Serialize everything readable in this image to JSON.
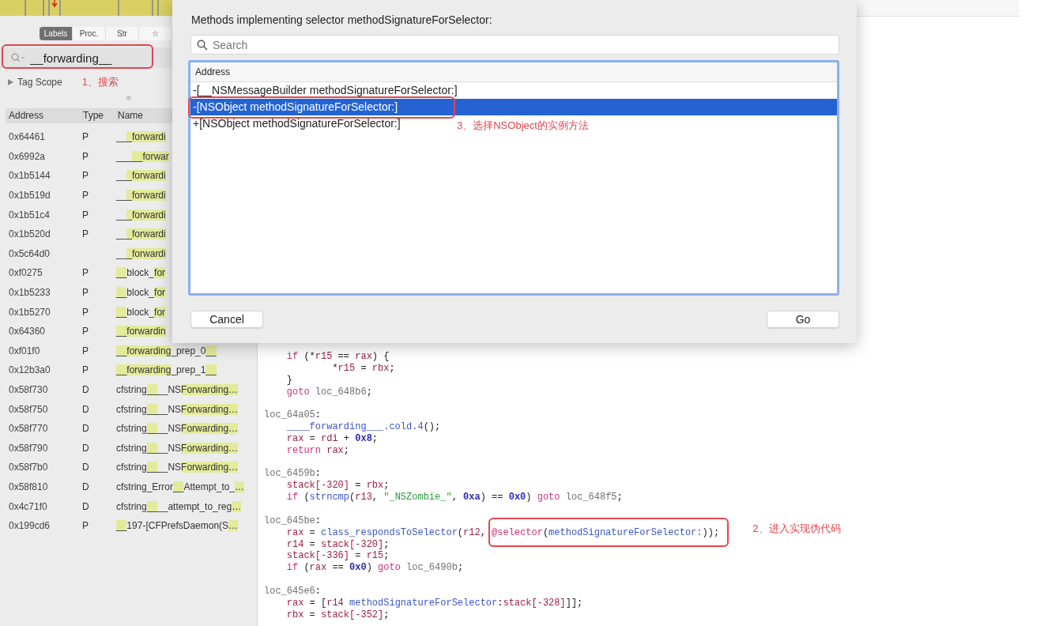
{
  "sidebar": {
    "tabs": [
      {
        "label": "Labels",
        "selected": true
      },
      {
        "label": "Proc.",
        "selected": false
      },
      {
        "label": "Str",
        "selected": false
      },
      {
        "label": "☆",
        "selected": false
      }
    ],
    "search": {
      "value": "__forwarding__"
    },
    "tag_scope": {
      "label": "Tag Scope",
      "expanded": false
    },
    "note": "1、搜索",
    "table": {
      "columns": [
        "Address",
        "Type",
        "Name"
      ],
      "rows": [
        {
          "address": "0x64461",
          "type": "P",
          "name": [
            {
              "text": "__",
              "match": false
            },
            {
              "text": "_forwardi",
              "match": true
            }
          ]
        },
        {
          "address": "0x6992a",
          "type": "P",
          "name": [
            {
              "text": "___",
              "match": false
            },
            {
              "text": "__forwar",
              "match": true
            }
          ]
        },
        {
          "address": "0x1b5144",
          "type": "P",
          "name": [
            {
              "text": "__",
              "match": false
            },
            {
              "text": "_forwardi",
              "match": true
            }
          ]
        },
        {
          "address": "0x1b519d",
          "type": "P",
          "name": [
            {
              "text": "__",
              "match": false
            },
            {
              "text": "_forwardi",
              "match": true
            }
          ]
        },
        {
          "address": "0x1b51c4",
          "type": "P",
          "name": [
            {
              "text": "__",
              "match": false
            },
            {
              "text": "_forwardi",
              "match": true
            }
          ]
        },
        {
          "address": "0x1b520d",
          "type": "P",
          "name": [
            {
              "text": "__",
              "match": false
            },
            {
              "text": "_forwardi",
              "match": true
            }
          ]
        },
        {
          "address": "0x5c64d0",
          "name": [
            {
              "text": "__",
              "match": false
            },
            {
              "text": "_forwardi",
              "match": true
            }
          ]
        },
        {
          "address": "0xf0275",
          "type": "P",
          "name": [
            {
              "text": "__",
              "match": true
            },
            {
              "text": "block_",
              "match": false
            },
            {
              "text": "for",
              "match": true
            }
          ]
        },
        {
          "address": "0x1b5233",
          "type": "P",
          "name": [
            {
              "text": "__",
              "match": true
            },
            {
              "text": "block_",
              "match": false
            },
            {
              "text": "for",
              "match": true
            }
          ]
        },
        {
          "address": "0x1b5270",
          "type": "P",
          "name": [
            {
              "text": "__",
              "match": true
            },
            {
              "text": "block_",
              "match": false
            },
            {
              "text": "for",
              "match": true
            }
          ]
        },
        {
          "address": "0x64360",
          "type": "P",
          "name": [
            {
              "text": "__forwardin",
              "match": true
            }
          ]
        },
        {
          "address": "0xf01f0",
          "type": "P",
          "name": [
            {
              "text": "__forwarding",
              "match": true
            },
            {
              "text": "_prep_0",
              "match": false
            },
            {
              "text": "__",
              "match": true
            }
          ]
        },
        {
          "address": "0x12b3a0",
          "type": "P",
          "name": [
            {
              "text": "__forwarding",
              "match": true
            },
            {
              "text": "_prep_1",
              "match": false
            },
            {
              "text": "__",
              "match": true
            }
          ]
        },
        {
          "address": "0x58f730",
          "type": "D",
          "name": [
            {
              "text": "cfstring",
              "match": false
            },
            {
              "text": "__",
              "match": true
            },
            {
              "text": "__NS",
              "match": false
            },
            {
              "text": "Forwarding…",
              "match": true
            }
          ]
        },
        {
          "address": "0x58f750",
          "type": "D",
          "name": [
            {
              "text": "cfstring",
              "match": false
            },
            {
              "text": "__",
              "match": true
            },
            {
              "text": "__NS",
              "match": false
            },
            {
              "text": "Forwarding…",
              "match": true
            }
          ]
        },
        {
          "address": "0x58f770",
          "type": "D",
          "name": [
            {
              "text": "cfstring",
              "match": false
            },
            {
              "text": "__",
              "match": true
            },
            {
              "text": "__NS",
              "match": false
            },
            {
              "text": "Forwarding…",
              "match": true
            }
          ]
        },
        {
          "address": "0x58f790",
          "type": "D",
          "name": [
            {
              "text": "cfstring",
              "match": false
            },
            {
              "text": "__",
              "match": true
            },
            {
              "text": "__NS",
              "match": false
            },
            {
              "text": "Forwarding…",
              "match": true
            }
          ]
        },
        {
          "address": "0x58f7b0",
          "type": "D",
          "name": [
            {
              "text": "cfstring",
              "match": false
            },
            {
              "text": "__",
              "match": true
            },
            {
              "text": "__NS",
              "match": false
            },
            {
              "text": "Forwarding…",
              "match": true
            }
          ]
        },
        {
          "address": "0x58f810",
          "type": "D",
          "name": [
            {
              "text": "cfstring_Error",
              "match": false
            },
            {
              "text": "__",
              "match": true
            },
            {
              "text": "Attempt_to_",
              "match": false
            },
            {
              "text": "…",
              "match": true
            }
          ]
        },
        {
          "address": "0x4c71f0",
          "type": "D",
          "name": [
            {
              "text": "cfstring",
              "match": false
            },
            {
              "text": "__",
              "match": true
            },
            {
              "text": "__attempt_to_reg",
              "match": false
            },
            {
              "text": "…",
              "match": true
            }
          ]
        },
        {
          "address": "0x199cd6",
          "type": "P",
          "name": [
            {
              "text": "__",
              "match": true
            },
            {
              "text": "197-[CFPrefsDaemon(S",
              "match": false
            },
            {
              "text": "…",
              "match": true
            }
          ]
        }
      ]
    }
  },
  "code": {
    "note": "2、进入实现伪代码",
    "lines": [
      {
        "kind": "body",
        "tokens": [
          {
            "kind": "keyword",
            "text": "if"
          },
          {
            "kind": "plain",
            "text": " (*"
          },
          {
            "kind": "var",
            "text": "r15"
          },
          {
            "kind": "plain",
            "text": " == "
          },
          {
            "kind": "var",
            "text": "rax"
          },
          {
            "kind": "plain",
            "text": ") {"
          }
        ]
      },
      {
        "kind": "nested",
        "tokens": [
          {
            "kind": "plain",
            "text": "*"
          },
          {
            "kind": "var",
            "text": "r15"
          },
          {
            "kind": "plain",
            "text": " = "
          },
          {
            "kind": "var",
            "text": "rbx"
          },
          {
            "kind": "plain",
            "text": ";"
          }
        ]
      },
      {
        "kind": "body",
        "tokens": [
          {
            "kind": "plain",
            "text": "}"
          }
        ]
      },
      {
        "kind": "body",
        "tokens": [
          {
            "kind": "keyword",
            "text": "goto "
          },
          {
            "kind": "label",
            "text": "loc_648b6"
          },
          {
            "kind": "plain",
            "text": ";"
          }
        ]
      },
      {
        "kind": "blank"
      },
      {
        "kind": "label",
        "tokens": [
          {
            "kind": "label",
            "text": "loc_64a05"
          },
          {
            "kind": "plain",
            "text": ":"
          }
        ]
      },
      {
        "kind": "body",
        "tokens": [
          {
            "kind": "func",
            "text": "____forwarding___.cold.4"
          },
          {
            "kind": "plain",
            "text": "();"
          }
        ]
      },
      {
        "kind": "body",
        "tokens": [
          {
            "kind": "var",
            "text": "rax"
          },
          {
            "kind": "plain",
            "text": " = "
          },
          {
            "kind": "var",
            "text": "rdi"
          },
          {
            "kind": "plain",
            "text": " + "
          },
          {
            "kind": "number",
            "text": "0x8"
          },
          {
            "kind": "plain",
            "text": ";"
          }
        ]
      },
      {
        "kind": "body",
        "tokens": [
          {
            "kind": "keyword",
            "text": "return "
          },
          {
            "kind": "var",
            "text": "rax"
          },
          {
            "kind": "plain",
            "text": ";"
          }
        ]
      },
      {
        "kind": "blank"
      },
      {
        "kind": "label",
        "tokens": [
          {
            "kind": "label",
            "text": "loc_6459b"
          },
          {
            "kind": "plain",
            "text": ":"
          }
        ]
      },
      {
        "kind": "body",
        "tokens": [
          {
            "kind": "var",
            "text": "stack[-320]"
          },
          {
            "kind": "plain",
            "text": " = "
          },
          {
            "kind": "var",
            "text": "rbx"
          },
          {
            "kind": "plain",
            "text": ";"
          }
        ]
      },
      {
        "kind": "body",
        "tokens": [
          {
            "kind": "keyword",
            "text": "if"
          },
          {
            "kind": "plain",
            "text": " ("
          },
          {
            "kind": "func",
            "text": "strncmp"
          },
          {
            "kind": "plain",
            "text": "("
          },
          {
            "kind": "var",
            "text": "r13"
          },
          {
            "kind": "plain",
            "text": ", "
          },
          {
            "kind": "string",
            "text": "\"_NSZombie_\""
          },
          {
            "kind": "plain",
            "text": ", "
          },
          {
            "kind": "number",
            "text": "0xa"
          },
          {
            "kind": "plain",
            "text": ") == "
          },
          {
            "kind": "number",
            "text": "0x0"
          },
          {
            "kind": "plain",
            "text": ") "
          },
          {
            "kind": "keyword",
            "text": "goto "
          },
          {
            "kind": "label",
            "text": "loc_648f5"
          },
          {
            "kind": "plain",
            "text": ";"
          }
        ]
      },
      {
        "kind": "blank"
      },
      {
        "kind": "label",
        "tokens": [
          {
            "kind": "label",
            "text": "loc_645be"
          },
          {
            "kind": "plain",
            "text": ":"
          }
        ]
      },
      {
        "kind": "body",
        "tokens": [
          {
            "kind": "var",
            "text": "rax"
          },
          {
            "kind": "plain",
            "text": " = "
          },
          {
            "kind": "func",
            "text": "class_respondsToSelector"
          },
          {
            "kind": "plain",
            "text": "("
          },
          {
            "kind": "var",
            "text": "r12"
          },
          {
            "kind": "plain",
            "text": ", "
          },
          {
            "kind": "keyword",
            "text": "@selector"
          },
          {
            "kind": "plain",
            "text": "("
          },
          {
            "kind": "func",
            "text": "methodSignatureForSelector:"
          },
          {
            "kind": "plain",
            "text": "));"
          }
        ]
      },
      {
        "kind": "body",
        "tokens": [
          {
            "kind": "var",
            "text": "r14"
          },
          {
            "kind": "plain",
            "text": " = "
          },
          {
            "kind": "var",
            "text": "stack[-320]"
          },
          {
            "kind": "plain",
            "text": ";"
          }
        ]
      },
      {
        "kind": "body",
        "tokens": [
          {
            "kind": "var",
            "text": "stack[-336]"
          },
          {
            "kind": "plain",
            "text": " = "
          },
          {
            "kind": "var",
            "text": "r15"
          },
          {
            "kind": "plain",
            "text": ";"
          }
        ]
      },
      {
        "kind": "body",
        "tokens": [
          {
            "kind": "keyword",
            "text": "if"
          },
          {
            "kind": "plain",
            "text": " ("
          },
          {
            "kind": "var",
            "text": "rax"
          },
          {
            "kind": "plain",
            "text": " == "
          },
          {
            "kind": "number",
            "text": "0x0"
          },
          {
            "kind": "plain",
            "text": ") "
          },
          {
            "kind": "keyword",
            "text": "goto "
          },
          {
            "kind": "label",
            "text": "loc_6490b"
          },
          {
            "kind": "plain",
            "text": ";"
          }
        ]
      },
      {
        "kind": "blank"
      },
      {
        "kind": "label",
        "tokens": [
          {
            "kind": "label",
            "text": "loc_645e6"
          },
          {
            "kind": "plain",
            "text": ":"
          }
        ]
      },
      {
        "kind": "body",
        "tokens": [
          {
            "kind": "var",
            "text": "rax"
          },
          {
            "kind": "plain",
            "text": " = ["
          },
          {
            "kind": "var",
            "text": "r14"
          },
          {
            "kind": "func",
            "text": " methodSignatureForSelector"
          },
          {
            "kind": "plain",
            "text": ":"
          },
          {
            "kind": "var",
            "text": "stack[-328]"
          },
          {
            "kind": "plain",
            "text": "]];"
          }
        ]
      },
      {
        "kind": "body",
        "tokens": [
          {
            "kind": "var",
            "text": "rbx"
          },
          {
            "kind": "plain",
            "text": " = "
          },
          {
            "kind": "var",
            "text": "stack[-352]"
          },
          {
            "kind": "plain",
            "text": ";"
          }
        ]
      }
    ]
  },
  "dialog": {
    "title": "Methods implementing selector methodSignatureForSelector:",
    "search": {
      "placeholder": "Search"
    },
    "column": "Address",
    "rows": [
      {
        "text": "-[__NSMessageBuilder methodSignatureForSelector:]",
        "selected": false
      },
      {
        "text": "-[NSObject methodSignatureForSelector:]",
        "selected": true
      },
      {
        "text": "+[NSObject methodSignatureForSelector:]",
        "selected": false
      }
    ],
    "note": "3、选择NSObject的实例方法",
    "buttons": [
      "Cancel",
      "Go"
    ]
  }
}
